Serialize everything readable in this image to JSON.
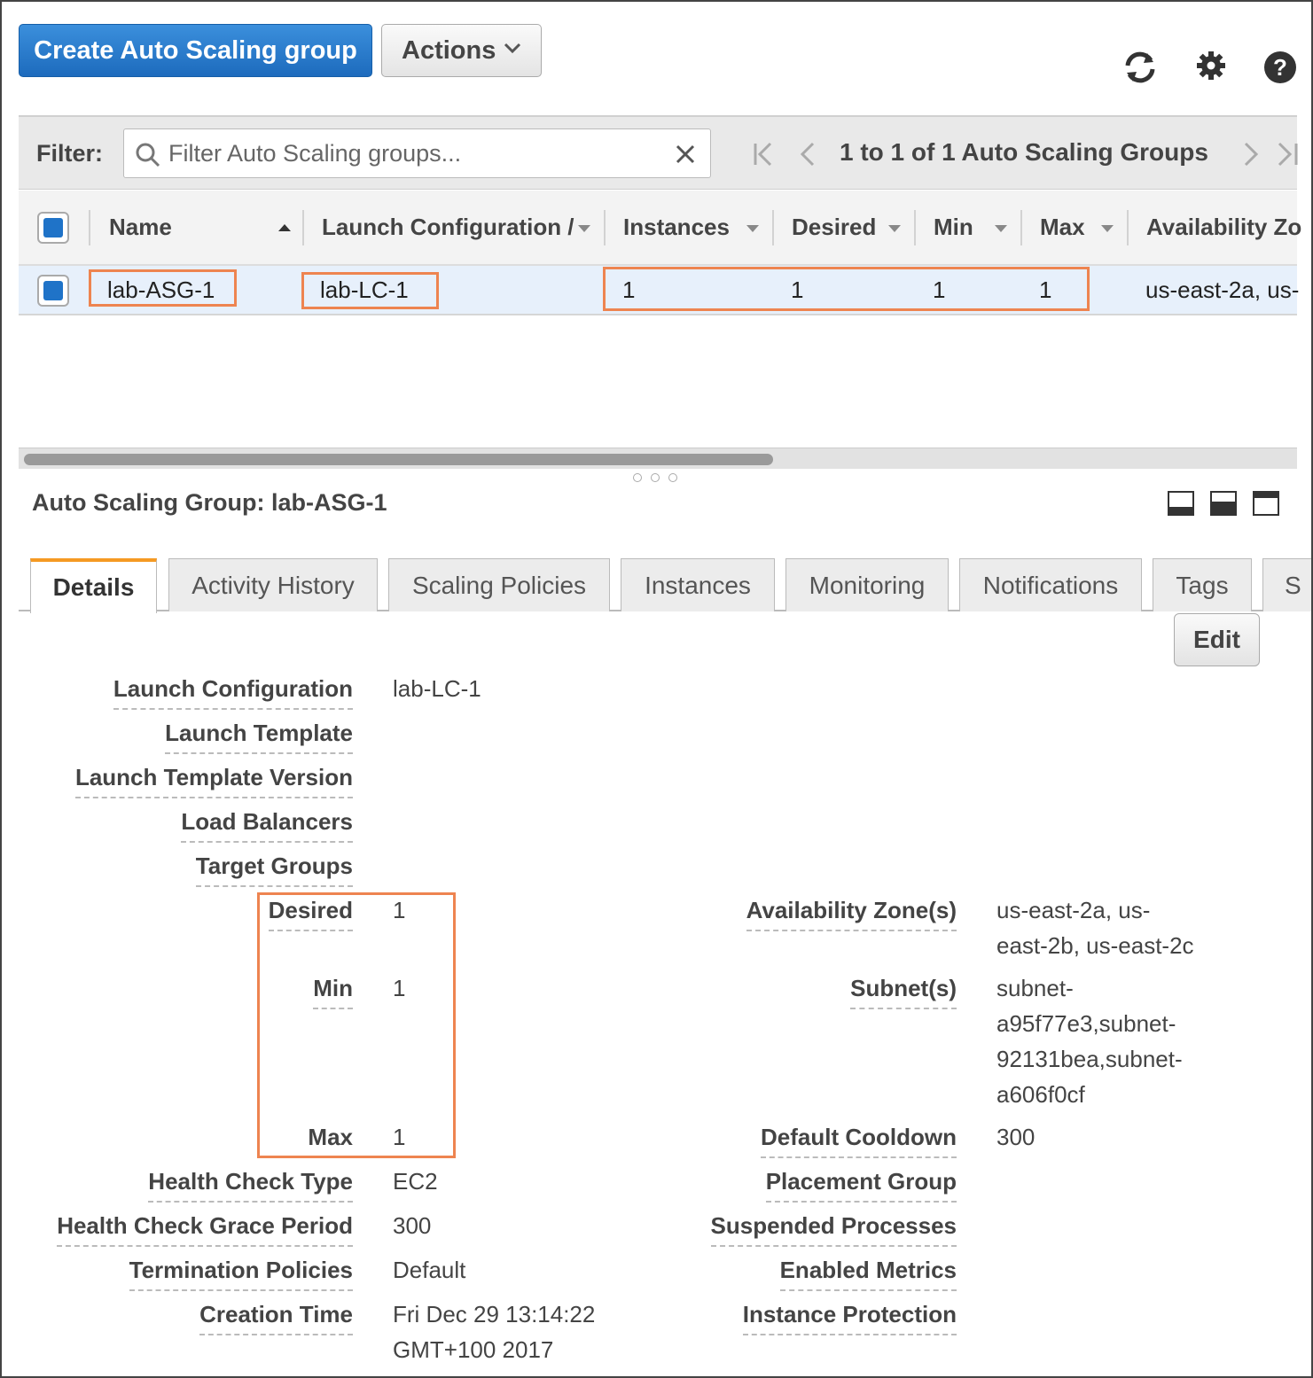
{
  "toolbar": {
    "create_label": "Create Auto Scaling group",
    "actions_label": "Actions"
  },
  "icons": [
    "refresh-icon",
    "gear-icon",
    "help-icon"
  ],
  "filter": {
    "label": "Filter:",
    "placeholder": "Filter Auto Scaling groups...",
    "pager_text": "1 to 1 of 1 Auto Scaling Groups"
  },
  "table": {
    "columns": [
      "Name",
      "Launch Configuration /",
      "Instances",
      "Desired",
      "Min",
      "Max",
      "Availability Zo"
    ],
    "rows": [
      {
        "name": "lab-ASG-1",
        "launch_config": "lab-LC-1",
        "instances": "1",
        "desired": "1",
        "min": "1",
        "max": "1",
        "az": "us-east-2a, us-"
      }
    ]
  },
  "detail": {
    "title": "Auto Scaling Group: lab-ASG-1",
    "tabs": [
      "Details",
      "Activity History",
      "Scaling Policies",
      "Instances",
      "Monitoring",
      "Notifications",
      "Tags",
      "S"
    ],
    "edit_label": "Edit",
    "left": [
      {
        "label": "Launch Configuration",
        "value": "lab-LC-1"
      },
      {
        "label": "Launch Template",
        "value": ""
      },
      {
        "label": "Launch Template Version",
        "value": ""
      },
      {
        "label": "Load Balancers",
        "value": ""
      },
      {
        "label": "Target Groups",
        "value": ""
      },
      {
        "label": "Desired",
        "value": "1"
      },
      {
        "label": "Min",
        "value": "1"
      },
      {
        "label": "Max",
        "value": "1"
      },
      {
        "label": "Health Check Type",
        "value": "EC2"
      },
      {
        "label": "Health Check Grace Period",
        "value": "300"
      },
      {
        "label": "Termination Policies",
        "value": "Default"
      },
      {
        "label": "Creation Time",
        "value_lines": [
          "Fri Dec 29 13:14:22",
          "GMT+100 2017"
        ]
      }
    ],
    "right": [
      {
        "label": "Availability Zone(s)",
        "value_lines": [
          "us-east-2a, us-",
          "east-2b, us-east-2c"
        ]
      },
      {
        "label": "Subnet(s)",
        "value_lines": [
          "subnet-",
          "a95f77e3,subnet-",
          "92131bea,subnet-",
          "a606f0cf"
        ]
      },
      {
        "label": "Default Cooldown",
        "value": "300"
      },
      {
        "label": "Placement Group",
        "value": ""
      },
      {
        "label": "Suspended Processes",
        "value": ""
      },
      {
        "label": "Enabled Metrics",
        "value": ""
      },
      {
        "label": "Instance Protection",
        "value": ""
      }
    ]
  },
  "colors": {
    "primary": "#1f73c8",
    "highlight": "#ee8450",
    "tab_accent": "#f59a23"
  }
}
